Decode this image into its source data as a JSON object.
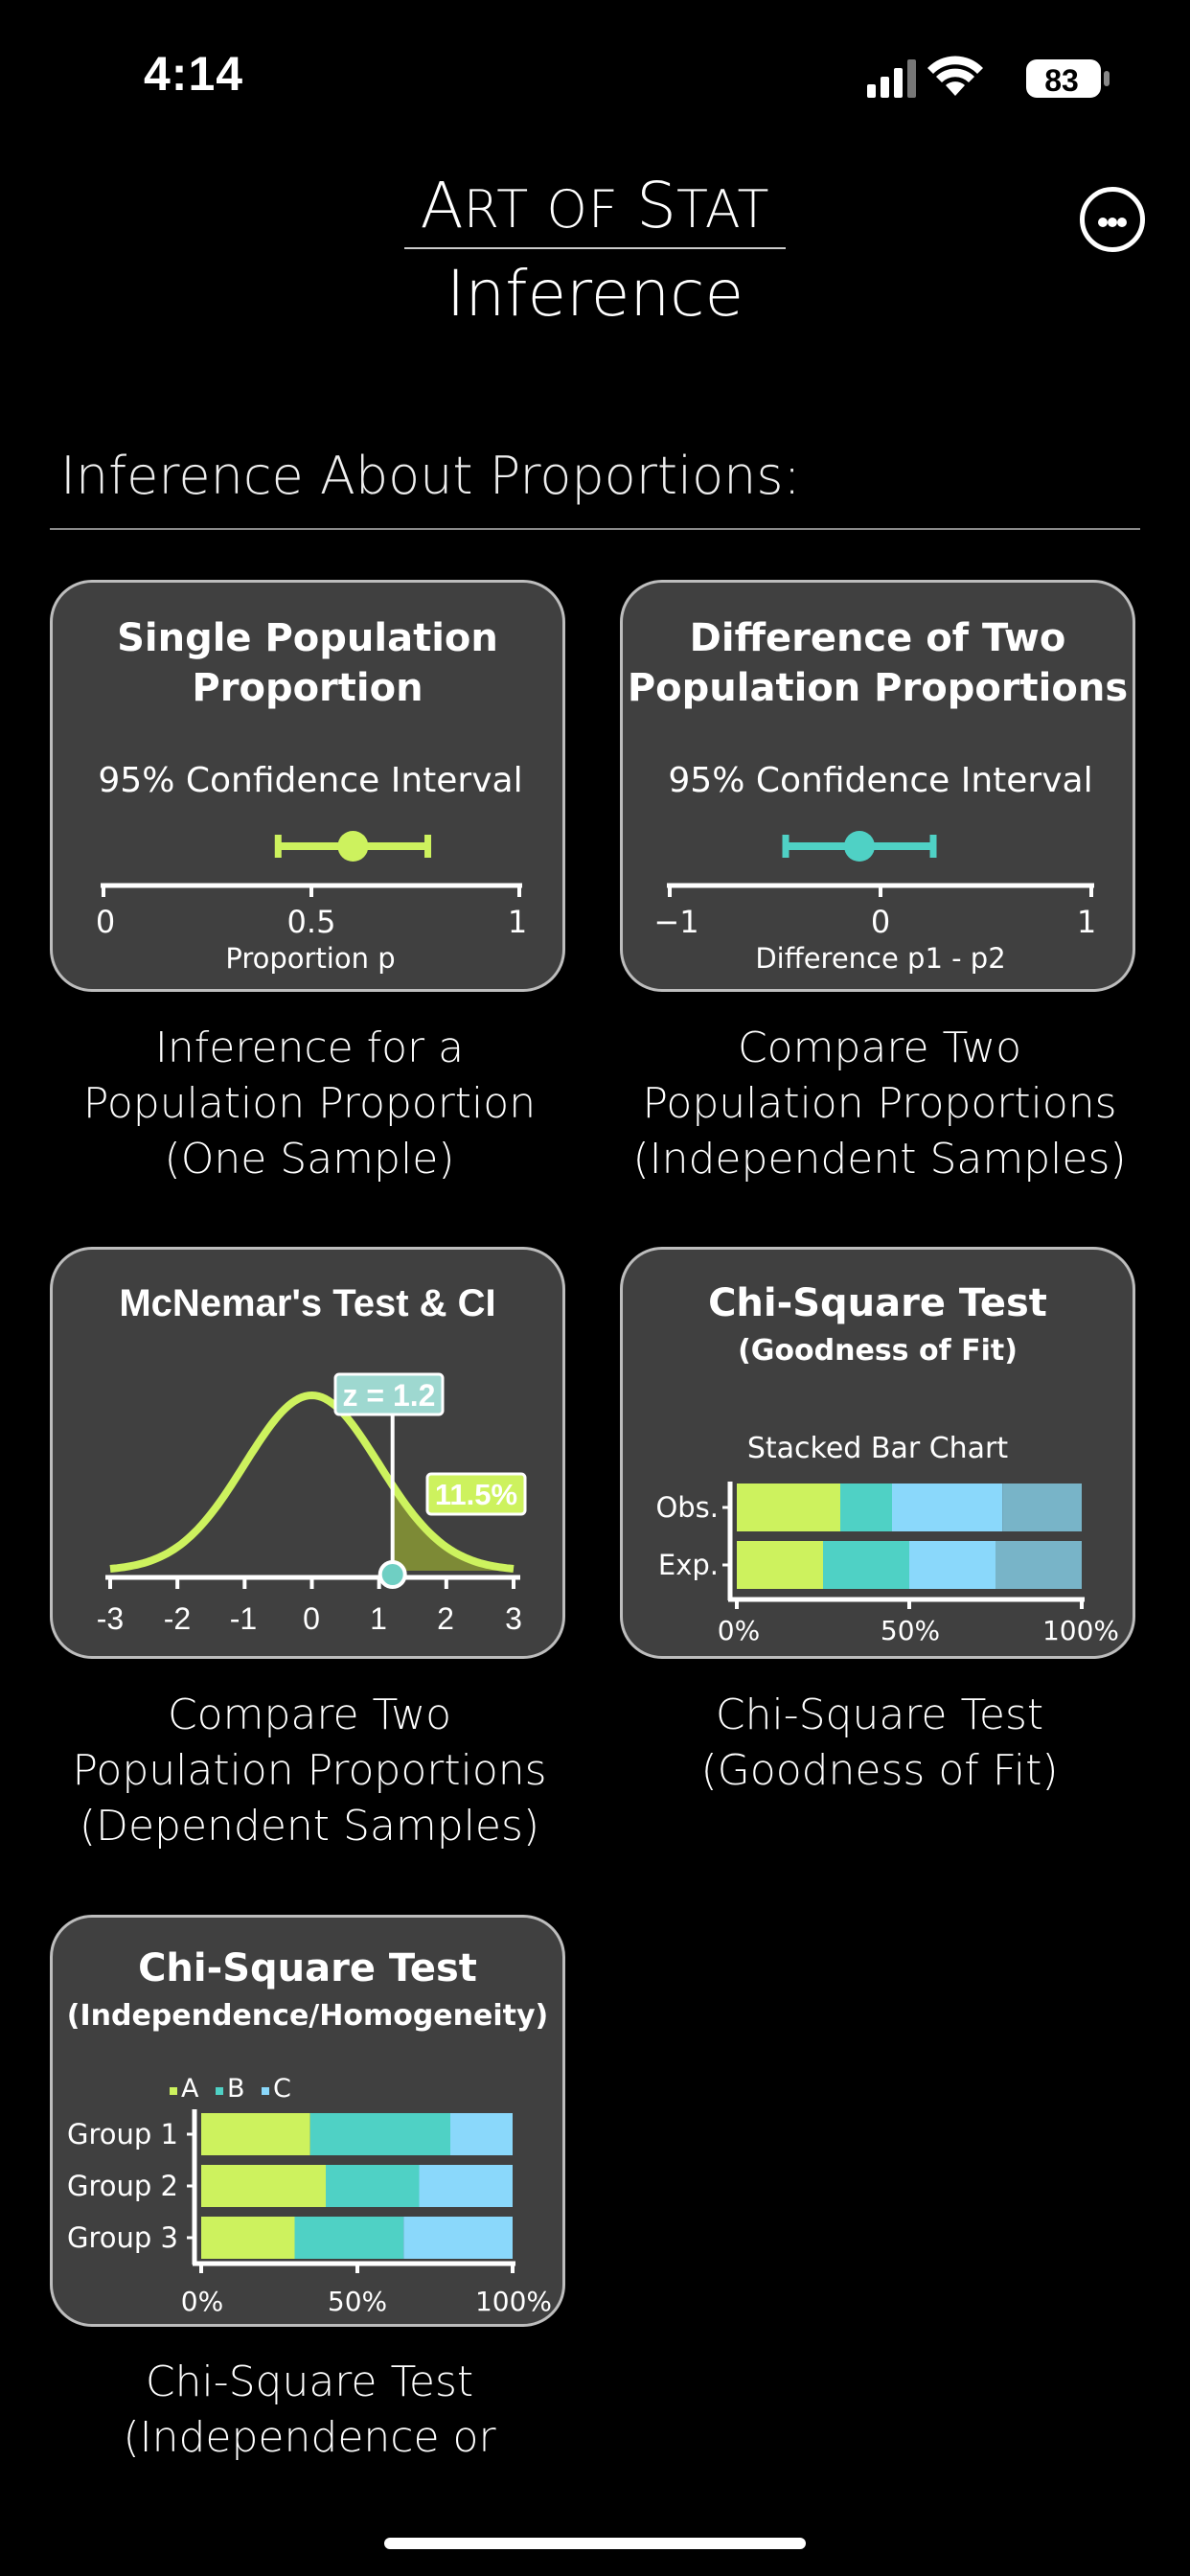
{
  "status": {
    "time": "4:14",
    "battery": "83"
  },
  "header": {
    "brand_A": "A",
    "brand_rt": "RT OF ",
    "brand_S": "S",
    "brand_tat": "TAT",
    "subtitle": "Inference",
    "menu_icon": "ellipsis-circle-icon"
  },
  "section": {
    "title": "Inference About Proportions:"
  },
  "colors": {
    "lime": "#cdf25e",
    "teal": "#4fd1c5",
    "sky": "#8ad8fb",
    "steel": "#78b4c8",
    "card_bg": "#404040"
  },
  "cards": [
    {
      "title_line1": "Single Population",
      "title_line2": "Proportion",
      "ci_label": "95% Confidence Interval",
      "ticks": [
        "0",
        "0.5",
        "1"
      ],
      "axis_label": "Proportion p",
      "ci": {
        "low": 0.42,
        "point": 0.6,
        "high": 0.78
      },
      "caption": [
        "Inference for a",
        "Population Proportion",
        "(One Sample)"
      ]
    },
    {
      "title_line1": "Difference of Two",
      "title_line2": "Population Proportions",
      "ci_label": "95% Confidence Interval",
      "ticks": [
        "−1",
        "0",
        "1"
      ],
      "axis_label": "Difference p1 - p2",
      "ci": {
        "low": -0.45,
        "point": -0.1,
        "high": 0.25
      },
      "caption": [
        "Compare Two",
        "Population Proportions",
        "(Independent Samples)"
      ]
    },
    {
      "title_line1": "McNemar's Test & CI",
      "z_label": "z = 1.2",
      "pct_label": "11.5%",
      "ticks": [
        "-3",
        "-2",
        "-1",
        "0",
        "1",
        "2",
        "3"
      ],
      "z": 1.2,
      "caption": [
        "Compare Two",
        "Population Proportions",
        "(Dependent Samples)"
      ]
    },
    {
      "title_line1": "Chi-Square Test",
      "title_line2": "(Goodness of Fit)",
      "chart_title": "Stacked Bar Chart",
      "rows": [
        "Obs.",
        "Exp."
      ],
      "ticks": [
        "0%",
        "50%",
        "100%"
      ],
      "caption": [
        "Chi-Square Test",
        "(Goodness of Fit)"
      ]
    },
    {
      "title_line1": "Chi-Square Test",
      "title_line2": "(Independence/Homogeneity)",
      "legend": [
        "A",
        "B",
        "C"
      ],
      "rows": [
        "Group 1",
        "Group 2",
        "Group 3"
      ],
      "ticks": [
        "0%",
        "50%",
        "100%"
      ],
      "caption": [
        "Chi-Square Test",
        "(Independence or"
      ]
    }
  ],
  "chart_data": [
    {
      "type": "bar",
      "stacked": true,
      "orientation": "horizontal",
      "title": "Stacked Bar Chart",
      "categories": [
        "Obs.",
        "Exp."
      ],
      "series": [
        {
          "values": [
            30,
            25
          ]
        },
        {
          "values": [
            15,
            25
          ]
        },
        {
          "values": [
            32,
            25
          ]
        },
        {
          "values": [
            23,
            25
          ]
        }
      ],
      "xlim": [
        0,
        100
      ]
    },
    {
      "type": "bar",
      "stacked": true,
      "orientation": "horizontal",
      "categories": [
        "Group 1",
        "Group 2",
        "Group 3"
      ],
      "series": [
        {
          "name": "A",
          "values": [
            35,
            40,
            30
          ]
        },
        {
          "name": "B",
          "values": [
            45,
            30,
            35
          ]
        },
        {
          "name": "C",
          "values": [
            20,
            30,
            35
          ]
        }
      ],
      "xlim": [
        0,
        100
      ],
      "legend": "top-left"
    }
  ]
}
